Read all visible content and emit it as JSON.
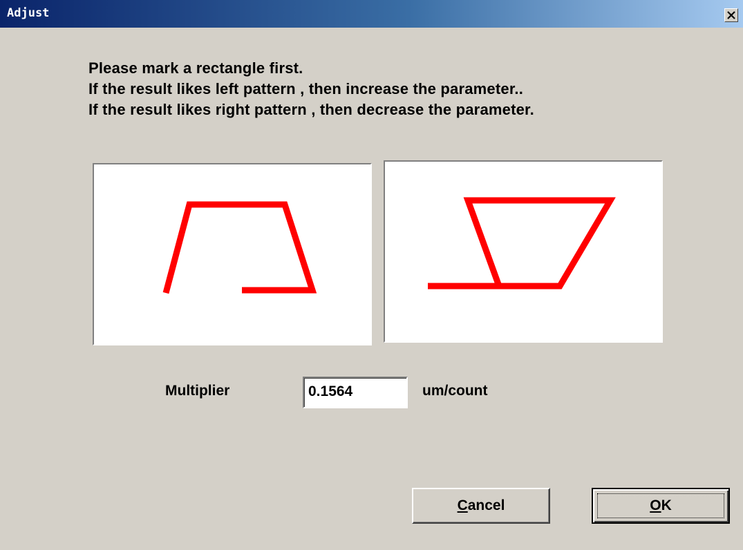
{
  "window": {
    "title": "Adjust",
    "close_icon": "close-icon"
  },
  "instructions": [
    "Please mark a rectangle first.",
    "If the result likes left pattern , then increase the parameter..",
    "If the result likes right pattern , then decrease the parameter."
  ],
  "patterns": {
    "stroke_color": "#ff0000",
    "left": "under-compensated-trapezoid",
    "right": "over-compensated-inverted-trapezoid"
  },
  "multiplier": {
    "label": "Multiplier",
    "value": "0.1564",
    "unit": "um/count"
  },
  "buttons": {
    "cancel_mnemonic": "C",
    "cancel_rest": "ancel",
    "ok_mnemonic": "O",
    "ok_rest": "K"
  }
}
